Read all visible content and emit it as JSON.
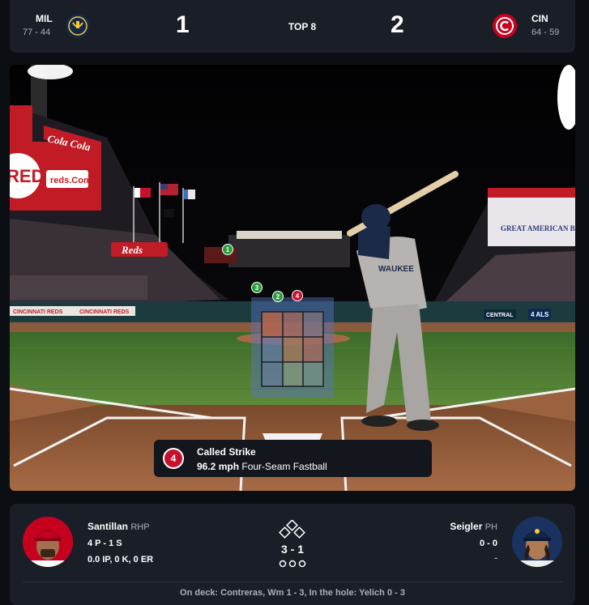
{
  "away": {
    "abbr": "MIL",
    "record": "77 - 44",
    "score": "1",
    "logo_icon": "brewers-logo-icon",
    "color": "#12284b"
  },
  "home": {
    "abbr": "CIN",
    "record": "64 - 59",
    "score": "2",
    "logo_icon": "reds-logo-icon",
    "color": "#c6011f"
  },
  "inning": "TOP 8",
  "field_signage": {
    "reds_board": "REDS",
    "url_board": "reds.Com",
    "cola_sign": "Cola Cola",
    "reds_sign": "Reds",
    "great_american": "GREAT AMERICAN BALL PARK",
    "cincinnati_left": "CINCINNATI REDS",
    "cincinnati_right": "CINCINNATI REDS",
    "central": "CENTRAL",
    "ad_4als": "4 ALS",
    "jersey": "WAUKEE"
  },
  "pitch_markers": [
    "1",
    "2",
    "3",
    "4"
  ],
  "last_pitch": {
    "number": "4",
    "result": "Called Strike",
    "speed": "96.2 mph",
    "type": "Four-Seam Fastball",
    "color": "#c8102e"
  },
  "pitcher": {
    "name": "Santillan",
    "position": "RHP",
    "pitches": "4 P - 1 S",
    "line": "0.0 IP, 0 K, 0 ER"
  },
  "batter": {
    "name": "Seigler",
    "position": "PH",
    "today": "0 - 0",
    "extra": "-"
  },
  "count": "3 - 1",
  "on_deck": "On deck: Contreras, Wm 1 - 3, In the hole: Yelich 0 - 3"
}
